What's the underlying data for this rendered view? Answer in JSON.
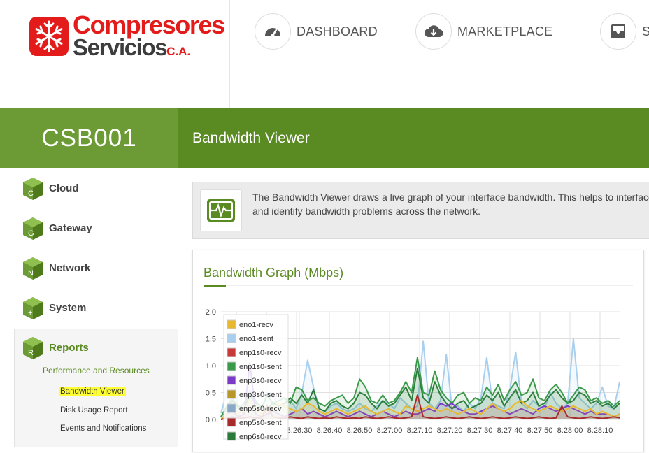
{
  "logo": {
    "line1": "Compresores",
    "line2": "Servicios",
    "suffix": "C.A."
  },
  "nav": [
    {
      "label": "DASHBOARD",
      "icon": "dashboard-gauge-icon"
    },
    {
      "label": "MARKETPLACE",
      "icon": "cloud-download-icon"
    },
    {
      "label": "S",
      "icon": "inbox-icon"
    }
  ],
  "host": "CSB001",
  "page_title": "Bandwidth Viewer",
  "sidebar": {
    "items": [
      {
        "label": "Cloud",
        "letter": "C"
      },
      {
        "label": "Gateway",
        "letter": "G"
      },
      {
        "label": "Network",
        "letter": "N"
      },
      {
        "label": "System",
        "letter": "+"
      },
      {
        "label": "Reports",
        "letter": "R"
      }
    ],
    "section": "Performance and Resources",
    "links": [
      "Bandwidth Viewer",
      "Disk Usage Report",
      "Events and Notifications"
    ]
  },
  "info": {
    "text": "The Bandwidth Viewer draws a live graph of your interface bandwidth. This helps to interfaces and identify bandwidth problems across the network.",
    "icon": "network-activity-icon"
  },
  "graph_title": "Bandwidth Graph (Mbps)",
  "colors": {
    "brand_green": "#5a8a22",
    "brand_red": "#e41b1b"
  },
  "chart_data": {
    "type": "area",
    "ylim": [
      0,
      2.0
    ],
    "yticks": [
      "0.0",
      "0.5",
      "1.0",
      "1.5",
      "2.0"
    ],
    "xticks": [
      "8:26:30",
      "8:26:40",
      "8:26:50",
      "8:27:00",
      "8:27:10",
      "8:27:20",
      "8:27:30",
      "8:27:40",
      "8:27:50",
      "8:28:00",
      "8:28:10"
    ],
    "legend": [
      {
        "name": "eno1-recv",
        "color": "#e8b930"
      },
      {
        "name": "eno1-sent",
        "color": "#a8cfee"
      },
      {
        "name": "enp1s0-recv",
        "color": "#c8393a"
      },
      {
        "name": "enp1s0-sent",
        "color": "#3a9a4a"
      },
      {
        "name": "enp3s0-recv",
        "color": "#7b3ac8"
      },
      {
        "name": "enp3s0-sent",
        "color": "#b8962a"
      },
      {
        "name": "enp5s0-recv",
        "color": "#8aa9c8"
      },
      {
        "name": "enp5s0-sent",
        "color": "#a82a2a"
      },
      {
        "name": "enp6s0-recv",
        "color": "#2a7a3a"
      }
    ],
    "series": [
      {
        "name": "eno1-sent",
        "color": "#a8cfee",
        "values": [
          0.12,
          0.5,
          1.1,
          0.2,
          0.15,
          0.55,
          0.35,
          0.2,
          0.5,
          0.45,
          0.25,
          0.3,
          0.35,
          0.2,
          0.5,
          1.1,
          0.6,
          0.2,
          0.15,
          0.25,
          0.3,
          0.2,
          0.15,
          0.2,
          0.3,
          0.2,
          0.15,
          0.25,
          0.35,
          0.3,
          0.2,
          0.4,
          0.3,
          0.2,
          0.25,
          1.45,
          0.3,
          0.2,
          0.35,
          1.2,
          0.2,
          0.25,
          0.15,
          0.3,
          0.2,
          0.4,
          1.15,
          0.3,
          0.25,
          0.2,
          0.55,
          1.25,
          0.3,
          0.2,
          0.35,
          0.25,
          0.2,
          0.5,
          0.3,
          0.2,
          0.3,
          1.5,
          0.4,
          0.3,
          0.2,
          0.3,
          0.6,
          0.25,
          0.2,
          0.7
        ]
      },
      {
        "name": "enp6s0-recv",
        "color": "#2a7a3a",
        "values": [
          0.05,
          0.2,
          0.35,
          0.25,
          0.2,
          0.45,
          0.3,
          0.25,
          0.2,
          0.3,
          0.25,
          0.3,
          0.4,
          0.3,
          0.45,
          0.3,
          0.55,
          0.2,
          0.15,
          0.3,
          0.35,
          0.25,
          0.2,
          0.3,
          0.5,
          0.45,
          0.3,
          0.2,
          0.35,
          0.25,
          0.3,
          0.45,
          0.6,
          0.35,
          0.95,
          0.4,
          0.3,
          0.7,
          0.45,
          0.3,
          0.2,
          0.3,
          0.35,
          0.2,
          0.25,
          0.3,
          0.45,
          0.35,
          0.5,
          0.25,
          0.4,
          0.55,
          0.3,
          0.35,
          0.5,
          0.25,
          0.3,
          0.45,
          0.55,
          0.4,
          0.3,
          0.35,
          0.5,
          0.45,
          0.3,
          0.35,
          0.25,
          0.3,
          0.2,
          0.3
        ]
      },
      {
        "name": "enp1s0-sent",
        "color": "#3a9a4a",
        "values": [
          0.05,
          0.25,
          0.4,
          0.2,
          0.3,
          0.5,
          0.35,
          0.2,
          0.45,
          0.3,
          0.35,
          0.4,
          0.3,
          0.6,
          0.55,
          0.35,
          0.4,
          0.3,
          0.25,
          0.35,
          0.4,
          0.45,
          0.3,
          0.4,
          0.75,
          0.6,
          0.35,
          0.3,
          0.45,
          0.3,
          0.35,
          0.5,
          0.7,
          0.5,
          1.15,
          0.5,
          0.45,
          0.9,
          0.55,
          0.4,
          0.3,
          0.45,
          0.5,
          0.3,
          0.4,
          0.35,
          0.6,
          0.45,
          0.65,
          0.35,
          0.55,
          0.7,
          0.45,
          0.5,
          0.75,
          0.4,
          0.35,
          0.55,
          0.65,
          0.5,
          0.3,
          0.45,
          0.6,
          0.55,
          0.35,
          0.4,
          0.3,
          0.35,
          0.25,
          0.35
        ]
      },
      {
        "name": "enp3s0-recv",
        "color": "#7b3ac8",
        "values": [
          0.0,
          0.1,
          0.15,
          0.05,
          0.1,
          1.05,
          0.1,
          0.05,
          0.1,
          0.15,
          0.1,
          0.05,
          0.1,
          0.15,
          0.2,
          0.1,
          0.15,
          0.1,
          0.05,
          0.1,
          0.15,
          0.1,
          0.05,
          0.1,
          0.15,
          0.1,
          0.05,
          0.1,
          0.15,
          0.1,
          0.05,
          0.1,
          0.15,
          0.1,
          0.1,
          0.15,
          0.2,
          0.15,
          0.3,
          0.25,
          0.3,
          0.2,
          0.15,
          0.1,
          0.1,
          0.15,
          0.2,
          0.25,
          0.2,
          0.15,
          0.1,
          0.15,
          0.2,
          0.15,
          0.1,
          0.2,
          0.25,
          0.2,
          0.15,
          0.2,
          0.25,
          0.2,
          0.15,
          0.1,
          0.15,
          0.1,
          0.1,
          0.1,
          0.05,
          0.1
        ]
      },
      {
        "name": "eno1-recv",
        "color": "#e8b930",
        "values": [
          0.0,
          0.1,
          0.25,
          0.1,
          0.15,
          0.35,
          0.2,
          0.1,
          0.15,
          0.2,
          0.3,
          0.25,
          0.2,
          0.15,
          0.2,
          0.3,
          0.25,
          0.15,
          0.1,
          0.15,
          0.2,
          0.15,
          0.1,
          0.15,
          0.2,
          0.25,
          0.15,
          0.1,
          0.15,
          0.2,
          0.15,
          0.1,
          0.25,
          0.2,
          0.15,
          0.2,
          0.25,
          0.2,
          0.15,
          0.2,
          0.15,
          0.1,
          0.15,
          0.2,
          0.15,
          0.1,
          0.2,
          0.3,
          0.2,
          0.15,
          0.2,
          0.3,
          0.35,
          0.25,
          0.2,
          0.15,
          0.2,
          0.25,
          0.2,
          0.15,
          0.2,
          0.25,
          0.2,
          0.15,
          0.2,
          0.1,
          0.15,
          0.1,
          0.05,
          0.1
        ]
      },
      {
        "name": "enp5s0-sent",
        "color": "#a82a2a",
        "values": [
          0.0,
          0.02,
          0.05,
          0.02,
          0.03,
          0.05,
          0.03,
          0.02,
          0.25,
          0.05,
          0.03,
          0.02,
          0.05,
          0.03,
          0.02,
          0.05,
          0.03,
          0.02,
          0.03,
          0.02,
          0.05,
          0.03,
          0.02,
          0.03,
          0.02,
          0.05,
          0.03,
          0.02,
          0.03,
          0.05,
          0.03,
          0.02,
          0.03,
          0.05,
          0.45,
          0.05,
          0.03,
          0.02,
          0.03,
          0.05,
          0.03,
          0.02,
          0.03,
          0.05,
          0.03,
          0.02,
          0.03,
          0.05,
          0.03,
          0.02,
          0.03,
          0.05,
          0.03,
          0.02,
          0.03,
          0.05,
          0.03,
          0.02,
          0.03,
          0.25,
          0.05,
          0.03,
          0.02,
          0.03,
          0.05,
          0.03,
          0.02,
          0.03,
          0.05,
          0.03
        ]
      }
    ]
  }
}
